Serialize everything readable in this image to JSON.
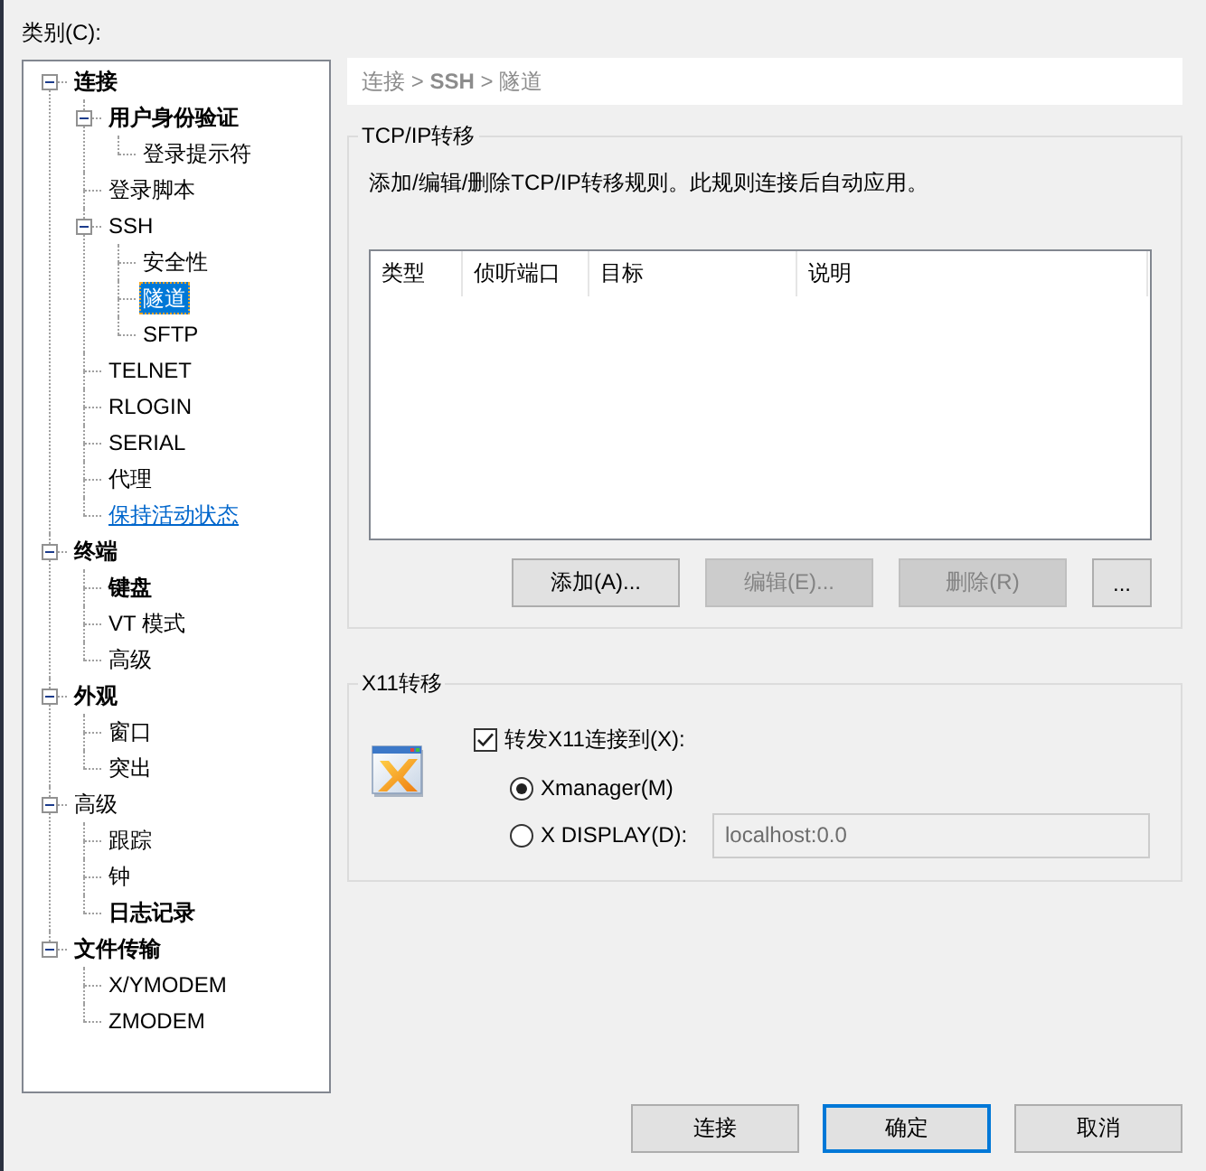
{
  "category_label": "类别(C):",
  "tree": [
    {
      "label": "连接",
      "kind": "item",
      "bold": true,
      "selected": false,
      "expanded": true,
      "children": [
        {
          "label": "用户身份验证",
          "kind": "item",
          "bold": true,
          "selected": false,
          "expanded": true,
          "children": [
            {
              "label": "登录提示符",
              "kind": "item",
              "bold": false,
              "selected": false
            }
          ]
        },
        {
          "label": "登录脚本",
          "kind": "item",
          "bold": false,
          "selected": false
        },
        {
          "label": "SSH",
          "kind": "item",
          "bold": false,
          "selected": false,
          "expanded": true,
          "children": [
            {
              "label": "安全性",
              "kind": "item",
              "bold": false,
              "selected": false
            },
            {
              "label": "隧道",
              "kind": "item",
              "bold": false,
              "selected": true
            },
            {
              "label": "SFTP",
              "kind": "item",
              "bold": false,
              "selected": false
            }
          ]
        },
        {
          "label": "TELNET",
          "kind": "item",
          "bold": false,
          "selected": false
        },
        {
          "label": "RLOGIN",
          "kind": "item",
          "bold": false,
          "selected": false
        },
        {
          "label": "SERIAL",
          "kind": "item",
          "bold": false,
          "selected": false
        },
        {
          "label": "代理",
          "kind": "item",
          "bold": false,
          "selected": false
        },
        {
          "label": "保持活动状态",
          "kind": "link",
          "bold": false,
          "selected": false
        }
      ]
    },
    {
      "label": "终端",
      "kind": "item",
      "bold": true,
      "selected": false,
      "expanded": true,
      "children": [
        {
          "label": "键盘",
          "kind": "item",
          "bold": true,
          "selected": false
        },
        {
          "label": "VT 模式",
          "kind": "item",
          "bold": false,
          "selected": false
        },
        {
          "label": "高级",
          "kind": "item",
          "bold": false,
          "selected": false
        }
      ]
    },
    {
      "label": "外观",
      "kind": "item",
      "bold": true,
      "selected": false,
      "expanded": true,
      "children": [
        {
          "label": "窗口",
          "kind": "item",
          "bold": false,
          "selected": false
        },
        {
          "label": "突出",
          "kind": "item",
          "bold": false,
          "selected": false
        }
      ]
    },
    {
      "label": "高级",
      "kind": "item",
      "bold": false,
      "selected": false,
      "expanded": true,
      "children": [
        {
          "label": "跟踪",
          "kind": "item",
          "bold": false,
          "selected": false
        },
        {
          "label": "钟",
          "kind": "item",
          "bold": false,
          "selected": false
        },
        {
          "label": "日志记录",
          "kind": "item",
          "bold": true,
          "selected": false
        }
      ]
    },
    {
      "label": "文件传输",
      "kind": "item",
      "bold": true,
      "selected": false,
      "expanded": true,
      "children": [
        {
          "label": "X/YMODEM",
          "kind": "item",
          "bold": false,
          "selected": false
        },
        {
          "label": "ZMODEM",
          "kind": "item",
          "bold": false,
          "selected": false
        }
      ]
    }
  ],
  "breadcrumb": "连接 > **SSH** > 隧道",
  "tcpip": {
    "title": "TCP/IP转移",
    "description": "添加/编辑/删除TCP/IP转移规则。此规则连接后自动应用。",
    "table": {
      "columns": [
        "类型",
        "侦听端口",
        "目标",
        "说明"
      ]
    },
    "buttons": [
      {
        "label": "添加(A)...",
        "kind": "standard",
        "disabled": false
      },
      {
        "label": "编辑(E)...",
        "kind": "standard",
        "disabled": true
      },
      {
        "label": "删除(R)",
        "kind": "standard",
        "disabled": true
      },
      {
        "label": "...",
        "kind": "compact",
        "disabled": false
      }
    ]
  },
  "x11": {
    "title": "X11转移",
    "forward": {
      "label": "转发X11连接到(X):",
      "checked": true
    },
    "options": [
      {
        "label": "Xmanager(M)",
        "selected": true
      },
      {
        "label": "X DISPLAY(D):",
        "selected": false
      }
    ],
    "display_field": {
      "value": "localhost:0.0",
      "disabled": true
    }
  },
  "buttons": [
    {
      "label": "连接",
      "default": false
    },
    {
      "label": "确定",
      "default": true
    },
    {
      "label": "取消",
      "default": false
    }
  ]
}
